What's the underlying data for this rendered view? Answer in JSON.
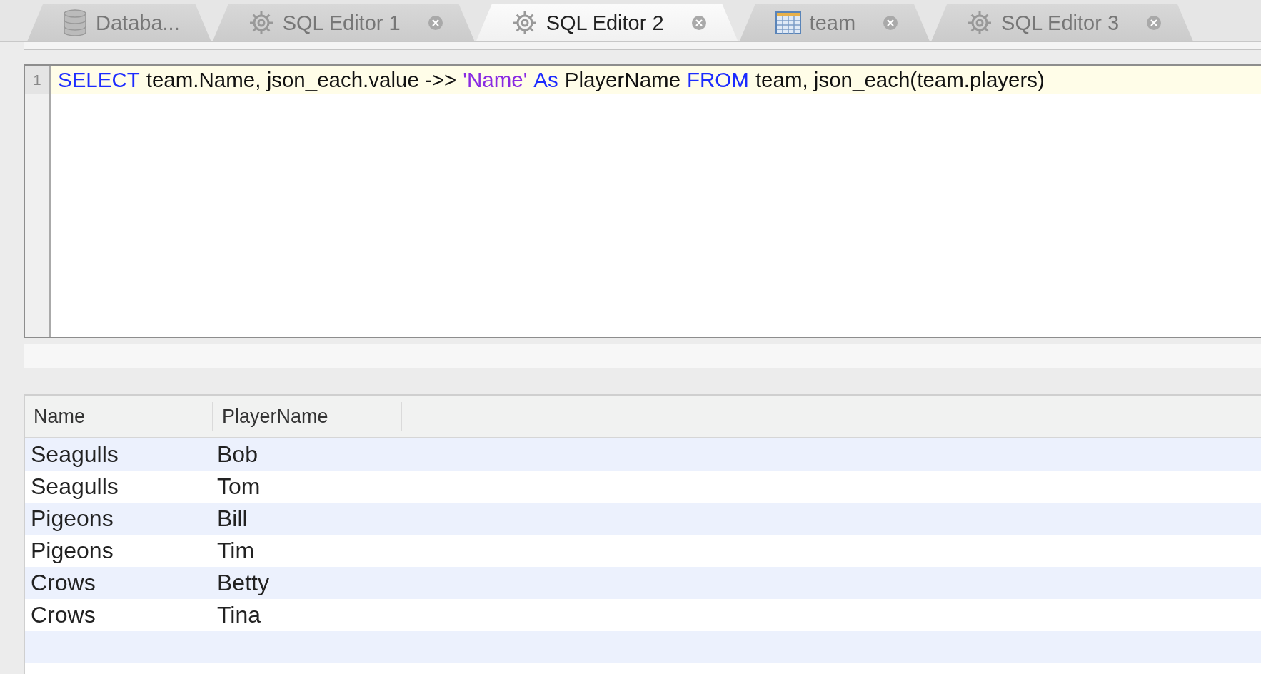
{
  "tabs": [
    {
      "label": "Databa...",
      "kind": "database",
      "selected": false,
      "closable": false
    },
    {
      "label": "SQL Editor 1",
      "kind": "editor",
      "selected": false,
      "closable": true
    },
    {
      "label": "SQL Editor 2",
      "kind": "editor",
      "selected": true,
      "closable": true
    },
    {
      "label": "team",
      "kind": "table",
      "selected": false,
      "closable": true
    },
    {
      "label": "SQL Editor 3",
      "kind": "editor",
      "selected": false,
      "closable": true
    }
  ],
  "editor": {
    "lines": [
      {
        "number": "1",
        "tokens": [
          {
            "kind": "keyword",
            "text": "SELECT"
          },
          {
            "kind": "plain",
            "text": "team.Name, json_each.value ->>"
          },
          {
            "kind": "string",
            "text": "'Name'"
          },
          {
            "kind": "keyword",
            "text": "As"
          },
          {
            "kind": "plain",
            "text": "PlayerName"
          },
          {
            "kind": "keyword",
            "text": "FROM"
          },
          {
            "kind": "plain",
            "text": "team, json_each(team.players)"
          }
        ]
      }
    ]
  },
  "results": {
    "columns": [
      "Name",
      "PlayerName"
    ],
    "rows": [
      [
        "Seagulls",
        "Bob"
      ],
      [
        "Seagulls",
        "Tom"
      ],
      [
        "Pigeons",
        "Bill"
      ],
      [
        "Pigeons",
        "Tim"
      ],
      [
        "Crows",
        "Betty"
      ],
      [
        "Crows",
        "Tina"
      ]
    ]
  }
}
